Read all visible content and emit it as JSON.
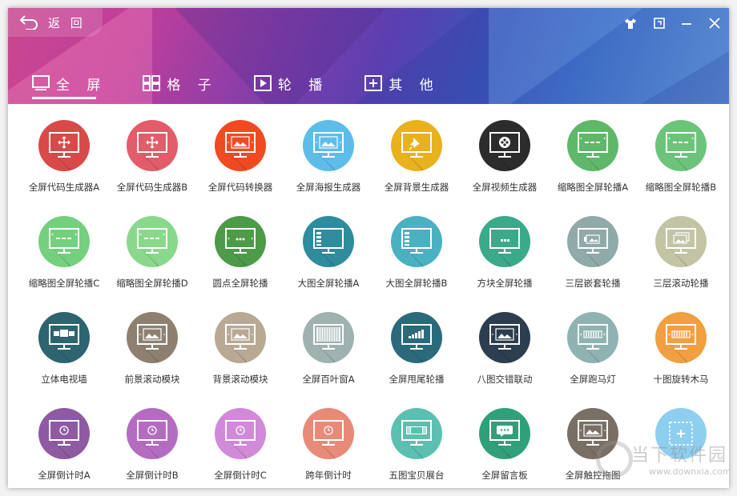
{
  "header": {
    "back_label": "返 回",
    "controls": [
      "shirt-icon",
      "screenshot-icon",
      "minimize-icon",
      "close-icon"
    ]
  },
  "tabs": [
    {
      "label": "全 屏",
      "icon": "fullscreen-icon",
      "active": true
    },
    {
      "label": "格 子",
      "icon": "grid-icon",
      "active": false
    },
    {
      "label": "轮 播",
      "icon": "play-icon",
      "active": false
    },
    {
      "label": "其 他",
      "icon": "plus-box-icon",
      "active": false
    }
  ],
  "items": [
    {
      "label": "全屏代码生成器A",
      "color": "#d84a4a",
      "glyph": "move"
    },
    {
      "label": "全屏代码生成器B",
      "color": "#e25c6a",
      "glyph": "move"
    },
    {
      "label": "全屏代码转换器",
      "color": "#f04a22",
      "glyph": "image"
    },
    {
      "label": "全屏海报生成器",
      "color": "#5dbde8",
      "glyph": "image"
    },
    {
      "label": "全屏背景生成器",
      "color": "#e8b21e",
      "glyph": "pin"
    },
    {
      "label": "全屏视频生成器",
      "color": "#2c2c2c",
      "glyph": "film"
    },
    {
      "label": "缩略图全屏轮播A",
      "color": "#5fb86a",
      "glyph": "slides"
    },
    {
      "label": "缩略图全屏轮播B",
      "color": "#6cc47a",
      "glyph": "slides"
    },
    {
      "label": "缩略图全屏轮播C",
      "color": "#74d07e",
      "glyph": "slides"
    },
    {
      "label": "缩略图全屏轮播D",
      "color": "#8ad88c",
      "glyph": "slides"
    },
    {
      "label": "圆点全屏轮播",
      "color": "#4d9a48",
      "glyph": "dots"
    },
    {
      "label": "大图全屏轮播A",
      "color": "#2e8c9c",
      "glyph": "list"
    },
    {
      "label": "大图全屏轮播B",
      "color": "#4ab1c0",
      "glyph": "list"
    },
    {
      "label": "方块全屏轮播",
      "color": "#3aaa8a",
      "glyph": "blocks"
    },
    {
      "label": "三层嵌套轮播",
      "color": "#8faaa8",
      "glyph": "nested"
    },
    {
      "label": "三层滚动轮播",
      "color": "#c2c4a4",
      "glyph": "stack"
    },
    {
      "label": "立体电视墙",
      "color": "#2d6470",
      "glyph": "tv"
    },
    {
      "label": "前景滚动模块",
      "color": "#8e8070",
      "glyph": "image"
    },
    {
      "label": "背景滚动模块",
      "color": "#b9a894",
      "glyph": "image"
    },
    {
      "label": "全屏百叶窗A",
      "color": "#9fb2b0",
      "glyph": "blinds"
    },
    {
      "label": "全屏甩尾轮播",
      "color": "#2b6a7a",
      "glyph": "bars"
    },
    {
      "label": "八图交错联动",
      "color": "#2c3e50",
      "glyph": "image"
    },
    {
      "label": "全屏跑马灯",
      "color": "#8fb3b3",
      "glyph": "marquee"
    },
    {
      "label": "十图旋转木马",
      "color": "#f0a040",
      "glyph": "marquee"
    },
    {
      "label": "全屏倒计时A",
      "color": "#8e5aa2",
      "glyph": "clock"
    },
    {
      "label": "全屏倒计时B",
      "color": "#b46cc0",
      "glyph": "clock"
    },
    {
      "label": "全屏倒计时C",
      "color": "#d08ad8",
      "glyph": "clock"
    },
    {
      "label": "跨年倒计时",
      "color": "#e88a78",
      "glyph": "clock"
    },
    {
      "label": "五图宝贝展台",
      "color": "#5cc0b0",
      "glyph": "film2"
    },
    {
      "label": "全屏留言板",
      "color": "#2fa07a",
      "glyph": "chat"
    },
    {
      "label": "全屏触控拖图",
      "color": "#7a6f64",
      "glyph": "image"
    },
    {
      "label": "",
      "color": "#8ecff0",
      "glyph": "add"
    }
  ],
  "watermark": {
    "title": "当下软件园",
    "subtitle": "www.downxia.com"
  }
}
